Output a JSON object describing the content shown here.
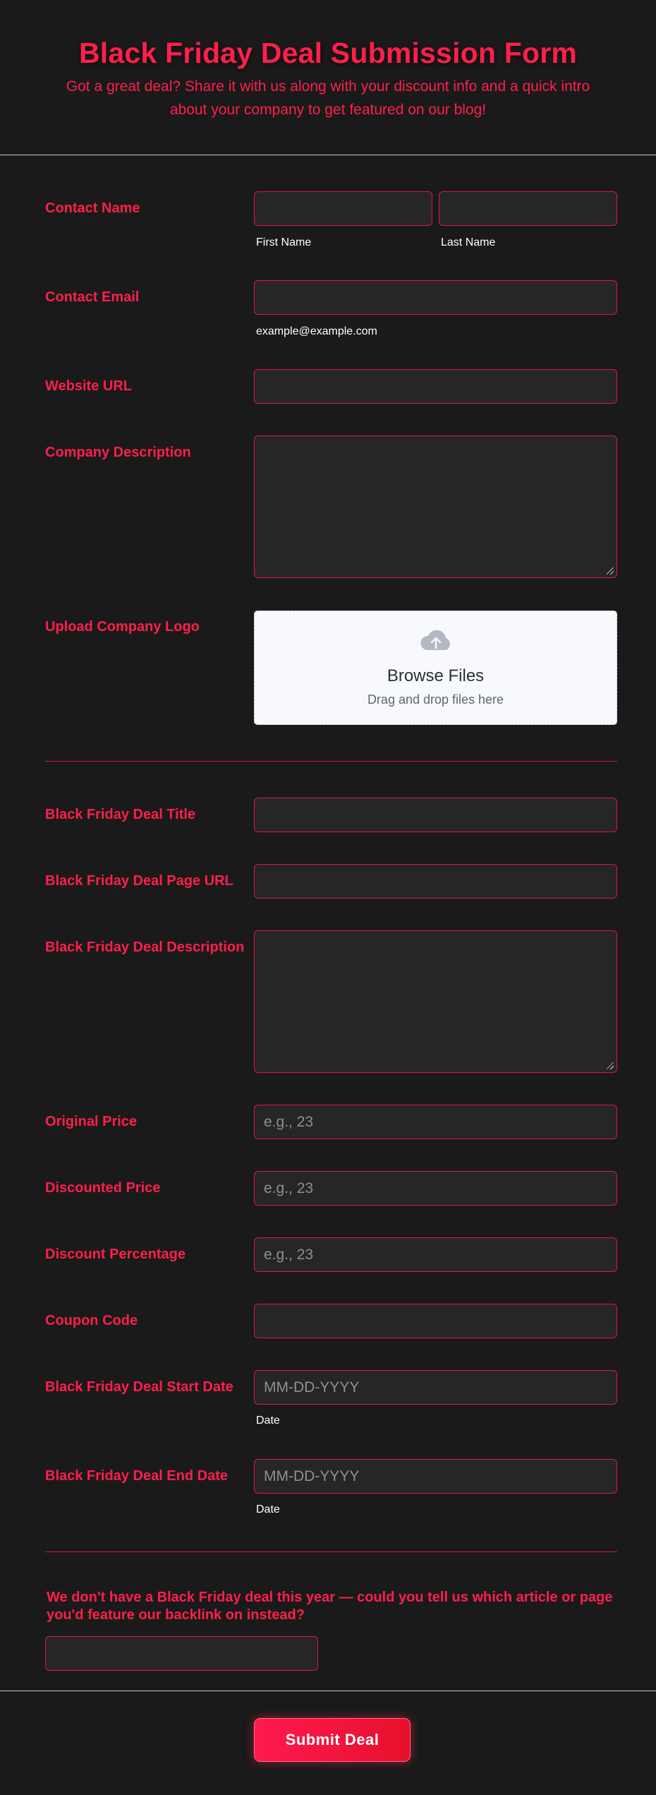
{
  "header": {
    "title": "Black Friday Deal Submission Form",
    "subtitle": "Got a great deal? Share it with us along with your discount info and a quick intro about your company to get featured on our blog!"
  },
  "contact": {
    "name_label": "Contact Name",
    "first_name_value": "",
    "first_name_sublabel": "First Name",
    "last_name_value": "",
    "last_name_sublabel": "Last Name",
    "email_label": "Contact Email",
    "email_value": "",
    "email_sublabel": "example@example.com",
    "website_label": "Website URL",
    "website_value": "",
    "description_label": "Company Description",
    "description_value": ""
  },
  "upload": {
    "label": "Upload Company Logo",
    "icon": "cloud-upload-icon",
    "title": "Browse Files",
    "hint": "Drag and drop files here"
  },
  "deal": {
    "title_label": "Black Friday Deal Title",
    "title_value": "",
    "page_url_label": "Black Friday Deal Page URL",
    "page_url_value": "",
    "description_label": "Black Friday Deal Description",
    "description_value": "",
    "original_price_label": "Original Price",
    "original_price_placeholder": "e.g., 23",
    "discounted_price_label": "Discounted Price",
    "discounted_price_placeholder": "e.g., 23",
    "discount_percentage_label": "Discount Percentage",
    "discount_percentage_placeholder": "e.g., 23",
    "coupon_label": "Coupon Code",
    "coupon_value": "",
    "start_date_label": "Black Friday Deal Start Date",
    "start_date_placeholder": "MM-DD-YYYY",
    "start_date_sublabel": "Date",
    "end_date_label": "Black Friday Deal End Date",
    "end_date_placeholder": "MM-DD-YYYY",
    "end_date_sublabel": "Date"
  },
  "alternative": {
    "question": "We don't have a Black Friday deal this year — could you tell us which article or page you'd feature our backlink on instead?",
    "answer_value": ""
  },
  "submit": {
    "label": "Submit Deal"
  },
  "colors": {
    "background": "#1a1a1a",
    "accent": "#ff1f4b",
    "field_background": "#262626",
    "field_border": "#e0173f",
    "upload_background": "#f8f9fd"
  }
}
